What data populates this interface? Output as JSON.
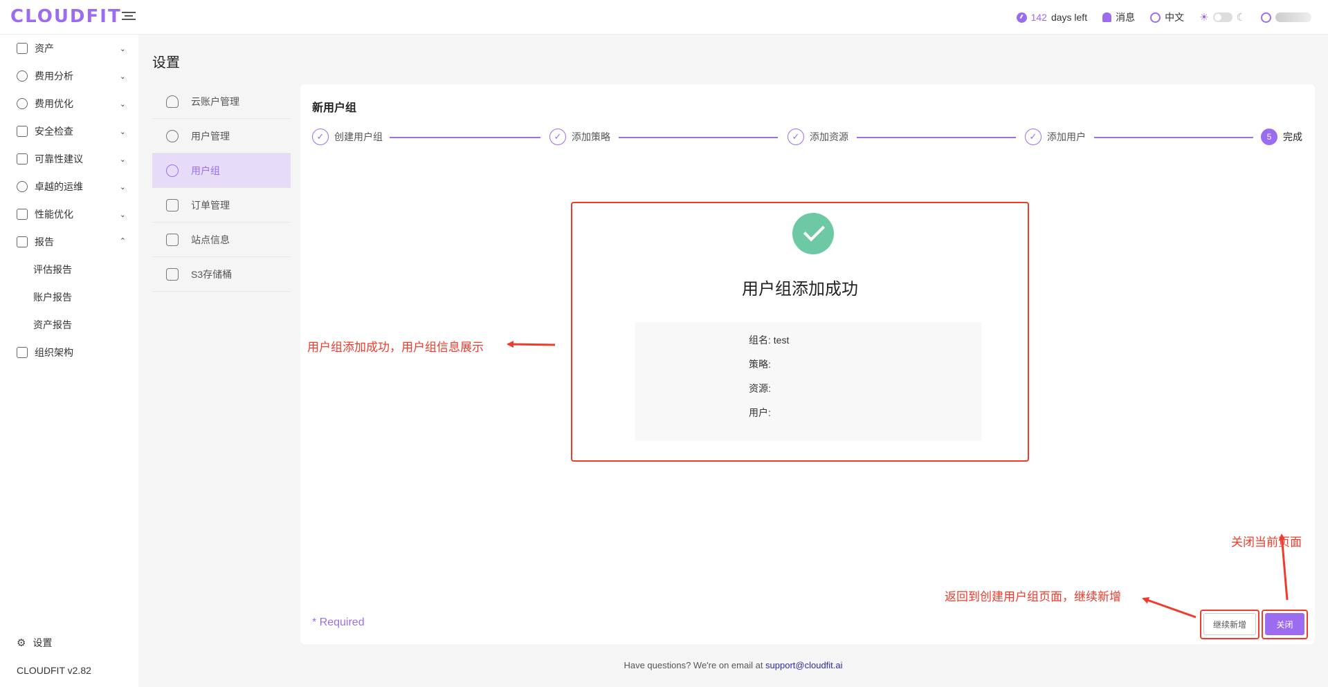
{
  "header": {
    "logo": "CLOUDFIT",
    "days_number": "142",
    "days_suffix": "days left",
    "messages": "消息",
    "language": "中文"
  },
  "sidebar": {
    "items": [
      {
        "label": "资产",
        "expanded": false
      },
      {
        "label": "费用分析",
        "expanded": false
      },
      {
        "label": "费用优化",
        "expanded": false
      },
      {
        "label": "安全检查",
        "expanded": false
      },
      {
        "label": "可靠性建议",
        "expanded": false
      },
      {
        "label": "卓越的运维",
        "expanded": false
      },
      {
        "label": "性能优化",
        "expanded": false
      },
      {
        "label": "报告",
        "expanded": true
      }
    ],
    "report_children": [
      "评估报告",
      "账户报告",
      "资产报告"
    ],
    "org": "组织架构",
    "settings": "设置",
    "version": "CLOUDFIT v2.82"
  },
  "page": {
    "title": "设置"
  },
  "submenu": {
    "items": [
      "云账户管理",
      "用户管理",
      "用户组",
      "订单管理",
      "站点信息",
      "S3存储桶"
    ],
    "active": "用户组"
  },
  "card": {
    "title": "新用户组",
    "steps": [
      {
        "label": "创建用户组",
        "status": "done"
      },
      {
        "label": "添加策略",
        "status": "done"
      },
      {
        "label": "添加资源",
        "status": "done"
      },
      {
        "label": "添加用户",
        "status": "done"
      },
      {
        "label": "完成",
        "status": "current",
        "number": "5"
      }
    ],
    "success_title": "用户组添加成功",
    "info": {
      "group_name": "组名: test",
      "policy": "策略:",
      "resource": "资源:",
      "user": "用户:"
    },
    "required": "* Required",
    "continue_button": "继续新增",
    "close_button": "关闭"
  },
  "annotations": {
    "info": "用户组添加成功，用户组信息展示",
    "back": "返回到创建用户组页面，继续新增",
    "close": "关闭当前页面"
  },
  "footer": {
    "text": "Have questions? We're on email at ",
    "email": "support@cloudfit.ai"
  },
  "colors": {
    "accent": "#9c6cf0",
    "success": "#6dc9a4",
    "annotation": "#f23a2a"
  }
}
